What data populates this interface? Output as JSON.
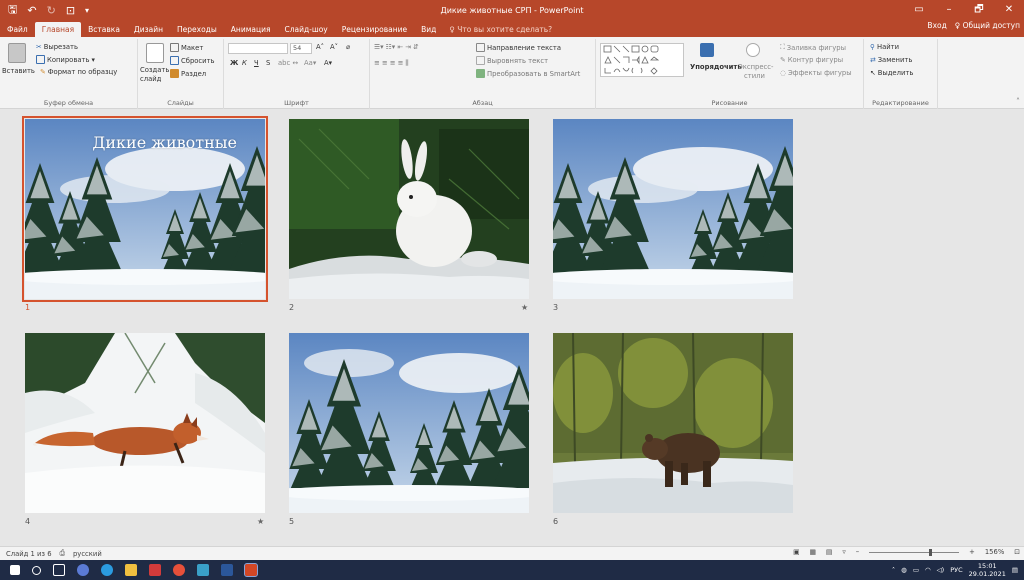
{
  "window": {
    "title": "Дикие животные СРП - PowerPoint",
    "controls": [
      "▭",
      "–",
      "🗗",
      "✕"
    ]
  },
  "tabs": {
    "items": [
      "Файл",
      "Главная",
      "Вставка",
      "Дизайн",
      "Переходы",
      "Анимация",
      "Слайд-шоу",
      "Рецензирование",
      "Вид"
    ],
    "active": "Главная",
    "tell_me": "♀ Что вы хотите сделать?",
    "signin": "Вход",
    "share": "♀ Общий доступ"
  },
  "ribbon": {
    "clipboard": {
      "paste": "Вставить",
      "cut": "Вырезать",
      "copy": "Копировать",
      "format_painter": "Формат по образцу",
      "label": "Буфер обмена"
    },
    "slides": {
      "new_slide": "Создать",
      "new_slide_2": "слайд",
      "layout": "Макет",
      "reset": "Сбросить",
      "section": "Раздел",
      "label": "Слайды"
    },
    "font": {
      "size": "54",
      "bold": "Ж",
      "italic": "К",
      "underline": "Ч",
      "strike": "S",
      "label": "Шрифт"
    },
    "paragraph": {
      "text_direction": "Направление текста",
      "align_text": "Выровнять текст",
      "smartart": "Преобразовать в SmartArt",
      "label": "Абзац"
    },
    "drawing": {
      "arrange": "Упорядочить",
      "quick_styles": "Экспресс-",
      "quick_styles_2": "стили",
      "shape_fill": "Заливка фигуры",
      "shape_outline": "Контур фигуры",
      "shape_effects": "Эффекты фигуры",
      "label": "Рисование"
    },
    "editing": {
      "find": "Найти",
      "replace": "Заменить",
      "select": "Выделить",
      "label": "Редактирование"
    }
  },
  "slides": [
    {
      "number": "1",
      "title": "Дикие животные",
      "scene": "forest",
      "selected": true
    },
    {
      "number": "2",
      "scene": "hare",
      "has_transition": true,
      "transition_mark": "★"
    },
    {
      "number": "3",
      "scene": "forest"
    },
    {
      "number": "4",
      "scene": "fox",
      "has_transition": true,
      "transition_mark": "★"
    },
    {
      "number": "5",
      "scene": "forest2"
    },
    {
      "number": "6",
      "scene": "bear"
    }
  ],
  "status": {
    "slide_info": "Слайд 1 из 6",
    "language": "русский",
    "zoom": "156%"
  },
  "taskbar": {
    "language": "РУС",
    "time": "15:01",
    "date": "29.01.2021"
  },
  "colors": {
    "accent": "#b7472a",
    "selection": "#d5532e"
  }
}
